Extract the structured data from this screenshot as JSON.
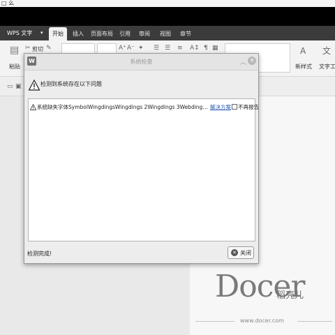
{
  "window": {
    "top_caption": "□ 么"
  },
  "menubar": {
    "app_name": "WPS 文字",
    "tabs": [
      "开始",
      "插入",
      "页面布局",
      "引用",
      "审阅",
      "视图",
      "章节"
    ],
    "active_tab": "开始"
  },
  "ribbon": {
    "paste_label": "粘贴",
    "cut_label": "剪切",
    "new_style_label": "新样式",
    "text_tools_label": "文字工具"
  },
  "dialog": {
    "title": "系统检查",
    "heading": "检测到系统存在以下问题",
    "issues": [
      {
        "text": "系统缺失字体SymbolWingdingsWingdings 2Wingdings 3WebdingsMT ExtraWPS...",
        "link": "解决方案",
        "checkbox_label": "不再报告",
        "checked": false
      }
    ],
    "status": "检测完成!",
    "close_button": "关闭"
  },
  "watermark": {
    "logo_text": "Docer",
    "logo_cn": "稻壳儿",
    "url": "www.docer.com"
  },
  "colors": {
    "menubar_bg": "#3b3b3b",
    "dialog_bg": "#ededed",
    "link": "#2a5db0"
  }
}
